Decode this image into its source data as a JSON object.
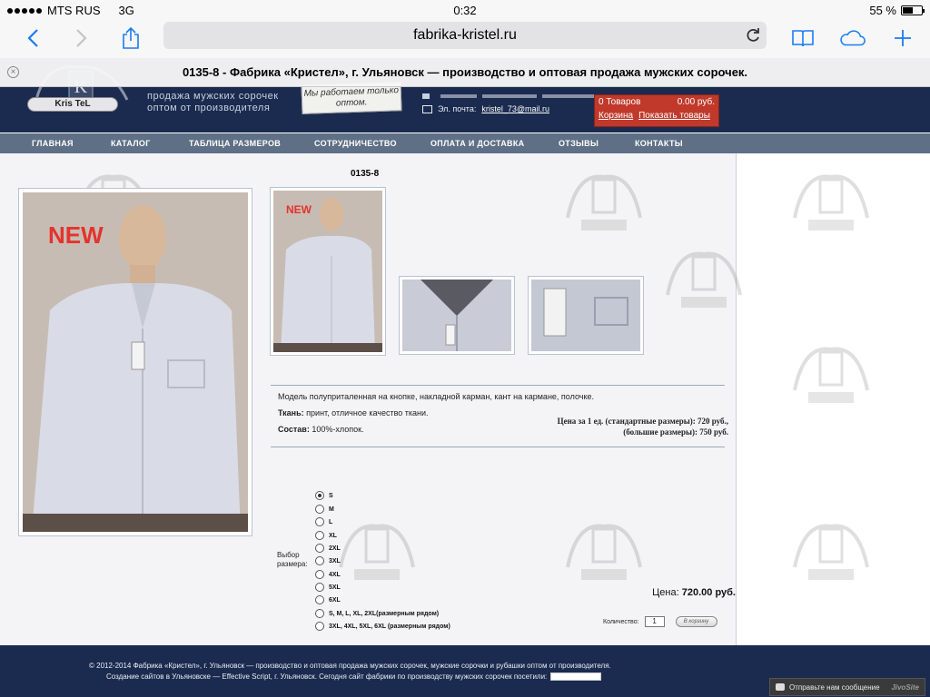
{
  "status_bar": {
    "carrier": "MTS RUS",
    "network": "3G",
    "time": "0:32",
    "battery": "55 %",
    "battery_level": 0.55
  },
  "browser": {
    "url": "fabrika-kristel.ru",
    "page_title": "0135-8 - Фабрика «Кристел», г. Ульяновск — производство и оптовая продажа мужских сорочек."
  },
  "header": {
    "logo_text": "Kris TeL",
    "tagline_line1": "продажа мужских сорочек",
    "tagline_line2": "оптом от производителя",
    "note": "Мы работаем только оптом.",
    "email_label": "Эл. почта:",
    "email": "kristel_73@mail.ru",
    "cart": {
      "count_text": "0 Товаров",
      "total_text": "0.00 руб.",
      "cart_link": "Корзина",
      "show_link": "Показать товары"
    }
  },
  "nav": {
    "items": [
      "ГЛАВНАЯ",
      "КАТАЛОГ",
      "ТАБЛИЦА РАЗМЕРОВ",
      "СОТРУДНИЧЕСТВО",
      "ОПЛАТА И ДОСТАВКА",
      "ОТЗЫВЫ",
      "КОНТАКТЫ"
    ]
  },
  "product": {
    "code": "0135-8",
    "badge": "NEW",
    "description": "Модель полуприталенная на кнопке, накладной карман, кант на кармане, полочке.",
    "fabric_label": "Ткань:",
    "fabric_value": "принт, отличное качество ткани.",
    "composition_label": "Состав:",
    "composition_value": "100%-хлопок.",
    "price_line1": "Цена за 1 ед. (стандартные размеры): 720 руб.,",
    "price_line2": "(большие размеры): 750 руб.",
    "size_label_1": "Выбор",
    "size_label_2": "размера:",
    "sizes": [
      "S",
      "M",
      "L",
      "XL",
      "2XL",
      "3XL",
      "4XL",
      "5XL",
      "6XL",
      "S, M, L, XL, 2XL(размерным рядом)",
      "3XL, 4XL, 5XL, 6XL (размерным рядом)"
    ],
    "selected_size": "S",
    "price_label": "Цена:",
    "price_value": "720.00 руб.",
    "qty_label": "Количество:",
    "qty_value": "1",
    "add_button": "В корзину"
  },
  "footer": {
    "line1": "© 2012-2014 Фабрика «Кристел», г. Ульяновск — производство и оптовая продажа мужских сорочек, мужские сорочки и рубашки оптом от производителя.",
    "line2": "Создание сайтов в Ульяновске — Effective Script, г. Ульяновск. Сегодня сайт фабрики по производству мужских сорочек посетили:"
  },
  "chat": {
    "label": "Отправьте нам сообщение",
    "brand": "JivoSite"
  }
}
